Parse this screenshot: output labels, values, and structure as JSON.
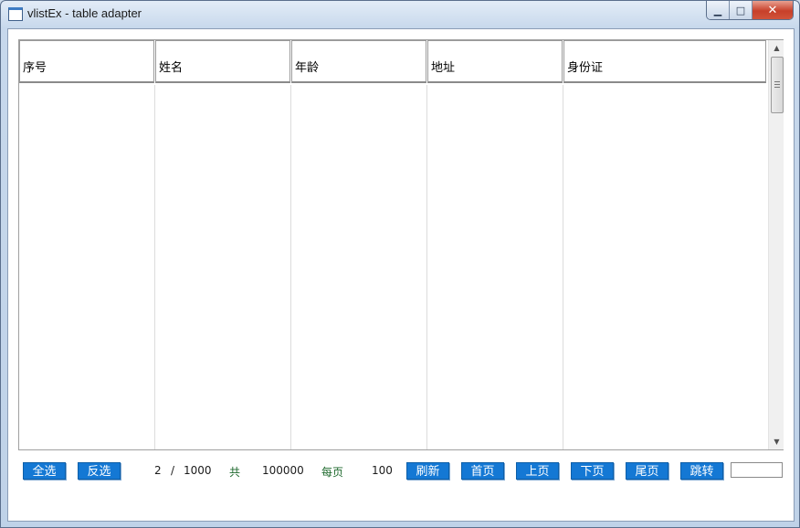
{
  "window": {
    "title": "vlistEx - table adapter",
    "minimize_glyph": "▁",
    "maximize_glyph": "□",
    "close_glyph": "✕"
  },
  "table": {
    "columns": [
      "序号",
      "姓名",
      "年龄",
      "地址",
      "身份证"
    ],
    "rows": []
  },
  "scrollbar": {
    "up_glyph": "▲",
    "down_glyph": "▼"
  },
  "toolbar": {
    "select_all": "全选",
    "invert_select": "反选",
    "current_page": "2",
    "page_separator": "/",
    "total_pages": "1000",
    "total_label": "共",
    "total_records": "100000",
    "per_page_label": "每页",
    "per_page_value": "100",
    "refresh": "刷新",
    "first_page": "首页",
    "prev_page": "上页",
    "next_page": "下页",
    "last_page": "尾页",
    "jump": "跳转",
    "jump_input_value": ""
  },
  "colors": {
    "button_blue": "#1478d4",
    "label_green": "#1f6a2e",
    "close_red": "#c7402a"
  }
}
